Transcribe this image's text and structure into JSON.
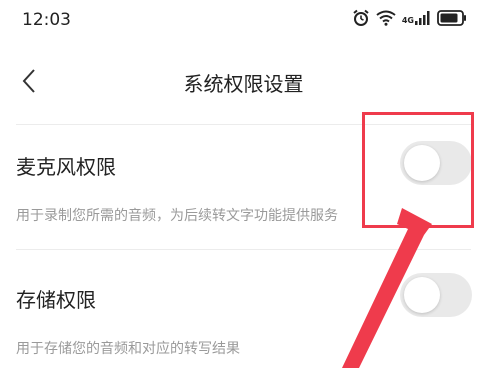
{
  "status_bar": {
    "time": "12:03",
    "network_label": "4G",
    "icons": [
      "alarm-icon",
      "wifi-icon",
      "signal-icon",
      "battery-icon"
    ]
  },
  "header": {
    "back_icon": "chevron-left-icon",
    "title": "系统权限设置"
  },
  "permissions": [
    {
      "title": "麦克风权限",
      "description": "用于录制您所需的音频，为后续转文字功能提供服务",
      "enabled": false
    },
    {
      "title": "存储权限",
      "description": "用于存储您的音频和对应的转写结果",
      "enabled": false
    }
  ],
  "annotation": {
    "color": "#ef3b4c"
  },
  "colors": {
    "toggle_off": "#e9e9e9",
    "text_primary": "#222222",
    "text_secondary": "#9a9a9a"
  }
}
